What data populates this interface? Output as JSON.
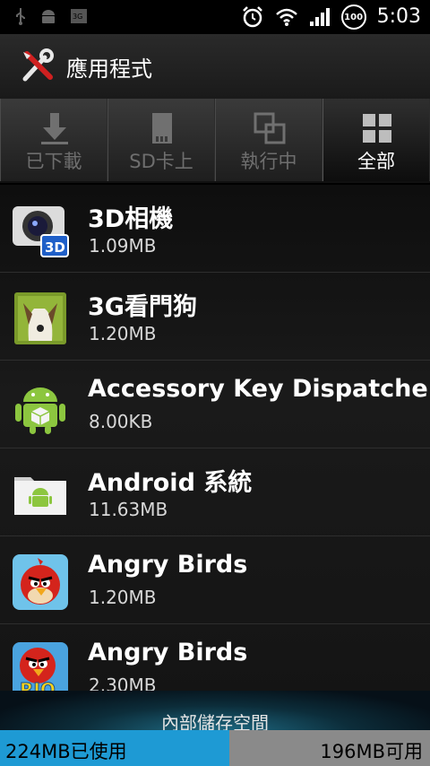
{
  "status_bar": {
    "time": "5:03",
    "battery": "100",
    "icons": [
      "usb-icon",
      "android-debug-icon",
      "3g-icon",
      "alarm-icon",
      "wifi-icon",
      "signal-icon",
      "battery-icon"
    ]
  },
  "header": {
    "title": "應用程式",
    "icon": "tools-icon"
  },
  "tabs": [
    {
      "label": "已下載",
      "icon": "download-icon",
      "active": false
    },
    {
      "label": "SD卡上",
      "icon": "sdcard-icon",
      "active": false
    },
    {
      "label": "執行中",
      "icon": "running-icon",
      "active": false
    },
    {
      "label": "全部",
      "icon": "grid-icon",
      "active": true
    }
  ],
  "apps": [
    {
      "name": "3D相機",
      "size": "1.09MB",
      "icon": "3d-camera-icon"
    },
    {
      "name": "3G看門狗",
      "size": "1.20MB",
      "icon": "3g-watchdog-icon"
    },
    {
      "name": "Accessory Key Dispatcher",
      "size": "8.00KB",
      "icon": "android-package-icon"
    },
    {
      "name": "Android 系統",
      "size": "11.63MB",
      "icon": "android-system-icon"
    },
    {
      "name": "Angry Birds",
      "size": "1.20MB",
      "icon": "angry-birds-icon"
    },
    {
      "name": "Angry Birds",
      "size": "2.30MB",
      "icon": "angry-birds-rio-icon"
    }
  ],
  "storage": {
    "label": "內部儲存空間",
    "used_text": "224MB已使用",
    "free_text": "196MB可用",
    "used_fraction": 0.533,
    "used_color": "#1e9ad4",
    "free_color": "#8a8a8a"
  }
}
